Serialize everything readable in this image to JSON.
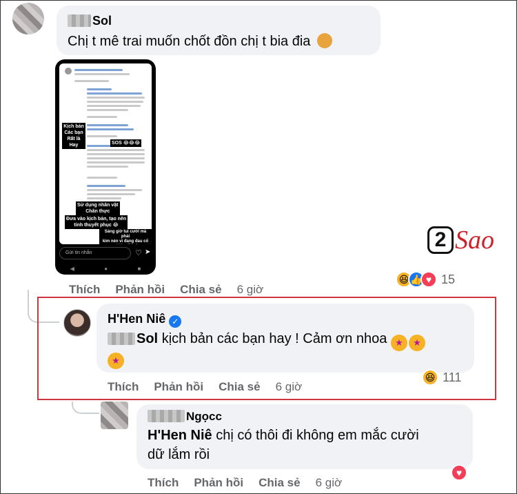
{
  "comment1": {
    "author_suffix": "Sol",
    "text": "Chị t mê trai muốn chốt đồn chị t bia đia",
    "actions": {
      "like": "Thích",
      "reply": "Phản hồi",
      "share": "Chia sẻ",
      "time": "6 giờ"
    },
    "reaction_count": "15",
    "reaction_icons": [
      "haha-icon",
      "like-icon",
      "love-icon"
    ]
  },
  "phone": {
    "overlay_labels": [
      "Kịch bản\nCác bạn\nRất là\nHay",
      "SOS 😂😂😂",
      "Sử dụng nhân vật\nChân thực",
      "Đưa vào kịch bản, tạo nên\ntính thuyết phục 😂",
      "Sáng giờ tui cười mà phải\nkìm nén vì đang đau cổ\ncười k nổi luôn"
    ],
    "input_placeholder": "Gửi tin nhắn"
  },
  "comment2": {
    "author": "H'Hen Niê",
    "verified": true,
    "tag_suffix": "Sol",
    "text": "kịch bản các bạn hay ! Cảm ơn nhoa",
    "actions": {
      "like": "Thích",
      "reply": "Phản hồi",
      "share": "Chia sẻ",
      "time": "6 giờ"
    },
    "reaction_count": "111"
  },
  "comment3": {
    "author_suffix": "Ngọcc",
    "tag": "H'Hen Niê",
    "text_line1": "chị có thôi đi không em mắc cười",
    "text_line2": "dữ lắm rồi",
    "actions": {
      "like": "Thích",
      "reply": "Phản hồi",
      "share": "Chia sẻ",
      "time": "6 giờ"
    }
  },
  "watermark": {
    "digit": "2",
    "word": "Sao"
  },
  "colors": {
    "highlight": "#d0343f",
    "link": "#1877f2",
    "muted": "#65676b",
    "bubble": "#f0f2f5"
  }
}
